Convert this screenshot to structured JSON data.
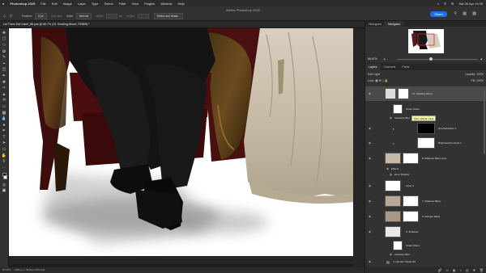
{
  "menubar": {
    "apple": "",
    "items": [
      "Photoshop 2025",
      "File",
      "Edit",
      "Image",
      "Layer",
      "Type",
      "Select",
      "Filter",
      "View",
      "Plugins",
      "Window",
      "Help"
    ],
    "clock": "Sat 26 Apr 11:09"
  },
  "options": {
    "window_title": "Adobe Photoshop 2025",
    "feather_label": "Feather:",
    "feather_value": "0 px",
    "antialias_label": "Anti-alias",
    "style_label": "Style:",
    "style_value": "Normal",
    "width_label": "Width:",
    "height_label": "Height:",
    "select_mask_label": "Select and Mask...",
    "share_label": "Share"
  },
  "document": {
    "tab_label": "Let Them Eat Cake!_88.psb @ 66.7% (13. Shading Above, RGB/8) *"
  },
  "status": {
    "zoom": "66.67%",
    "doc_info": "3326 px x 3948 px (300 ppi)"
  },
  "navigator": {
    "tabs": [
      "Histogram",
      "Navigator"
    ],
    "active_tab": "Navigator",
    "zoom": "66.67%"
  },
  "layers_panel": {
    "tabs": [
      "Layers",
      "Channels",
      "Paths"
    ],
    "active_tab": "Layers",
    "blend_mode": "Soft Light",
    "opacity_label": "Opacity:",
    "opacity": "100%",
    "lock_label": "Lock:",
    "fill_label": "Fill:",
    "fill": "100%"
  },
  "layers": [
    {
      "name": "13. Shading Above",
      "selected": true
    },
    {
      "name": "Smart Filters",
      "selected": false
    },
    {
      "name": "Gaussian Blur",
      "selected": false
    },
    {
      "name": "Hue/Saturation 1",
      "selected": false
    },
    {
      "name": "Brightness/Contrast 1",
      "selected": false
    },
    {
      "name": "8. Madame Blanc copy",
      "selected": false
    },
    {
      "name": "Effects",
      "selected": false
    },
    {
      "name": "Drop Shadow",
      "selected": false
    },
    {
      "name": "Layer 2",
      "selected": false
    },
    {
      "name": "7. Madame Blanc",
      "selected": false
    },
    {
      "name": "6. DeFrigo Ellips",
      "selected": false
    },
    {
      "name": "5. Shadows",
      "selected": false
    },
    {
      "name": "Smart Filters",
      "selected": false
    },
    {
      "name": "Gaussian Blur",
      "selected": false
    },
    {
      "name": "4. Hanniki Tripelk Off",
      "selected": false
    }
  ],
  "tooltip": "Filter effects mask",
  "colors": {
    "accent": "#1473e6",
    "panel": "#323232",
    "menubar": "#2b2b2b",
    "canvas": "#ffffff"
  }
}
